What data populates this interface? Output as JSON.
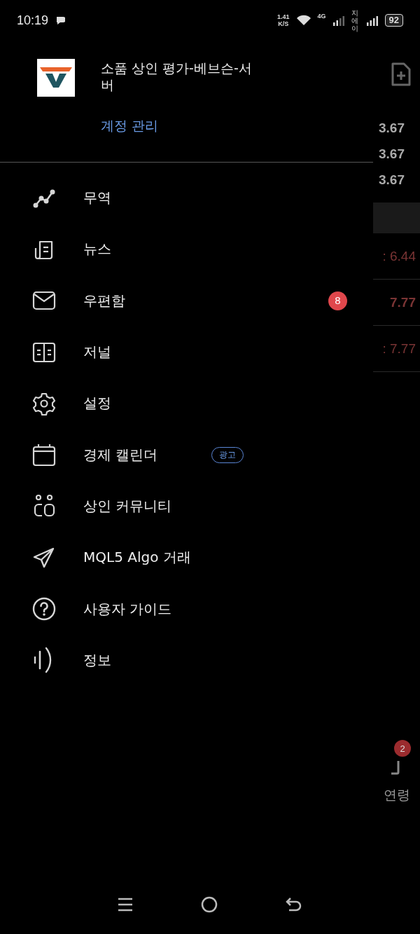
{
  "status_bar": {
    "time": "10:19",
    "speed_value": "1.41",
    "speed_unit": "K/S",
    "network": "4G",
    "carrier": "지에이",
    "battery": "92"
  },
  "drawer": {
    "account_name_lines": [
      "소품 상인 평가-베브슨-서",
      "버"
    ],
    "manage_account": "계정 관리",
    "items": [
      {
        "label": "무역",
        "kind": "plain"
      },
      {
        "label": "뉴스",
        "kind": "plain"
      },
      {
        "label": "우편함",
        "kind": "count",
        "badge": "8"
      },
      {
        "label": "저널",
        "kind": "plain"
      },
      {
        "label": "설정",
        "kind": "plain"
      },
      {
        "label": "경제 캘린더",
        "kind": "tag",
        "badge": "광고"
      },
      {
        "label": "상인 커뮤니티",
        "kind": "plain"
      },
      {
        "label": "MQL5 Algo 거래",
        "kind": "plain"
      },
      {
        "label": "사용자 가이드",
        "kind": "plain"
      },
      {
        "label": "정보",
        "kind": "plain"
      }
    ]
  },
  "background": {
    "prices": [
      "3.67",
      "3.67",
      "3.67"
    ],
    "changes": [
      {
        "text": ": 6.44",
        "bold": false
      },
      {
        "text": "7.77",
        "bold": true
      },
      {
        "text": ": 7.77",
        "bold": false
      }
    ],
    "tab_badge": "2",
    "tab_label": "연령"
  }
}
